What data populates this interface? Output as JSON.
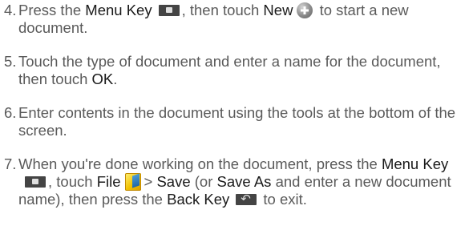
{
  "steps": [
    {
      "number": "4.",
      "t1": "Press the",
      "k1": "Menu Key",
      "t2": ", then touch",
      "k2": "New",
      "t3": "to start a new document.",
      "icons": [
        "menu-key-icon",
        "new-plus-icon"
      ]
    },
    {
      "number": "5.",
      "t1": "Touch the type of document and enter a name for the document, then touch",
      "k1": "OK",
      "t2": "."
    },
    {
      "number": "6.",
      "t1": "Enter contents in the document using the tools at the bottom of the screen."
    },
    {
      "number": "7.",
      "t1": "When you're done working on the document, press the",
      "k1": "Menu Key",
      "t2": ", touch",
      "k2": "File",
      "t3": ">",
      "k3": "Save",
      "t4": "(or",
      "k4": "Save As",
      "t5": "and enter a new document name), then press the",
      "k5": "Back Key",
      "t6": "to exit.",
      "icons": [
        "menu-key-icon",
        "file-folder-icon",
        "back-key-icon"
      ]
    }
  ],
  "colors": {
    "body_text": "#5a5a5a",
    "keyword_text": "#1a1a1a",
    "key_icon_bg": "#444444"
  }
}
